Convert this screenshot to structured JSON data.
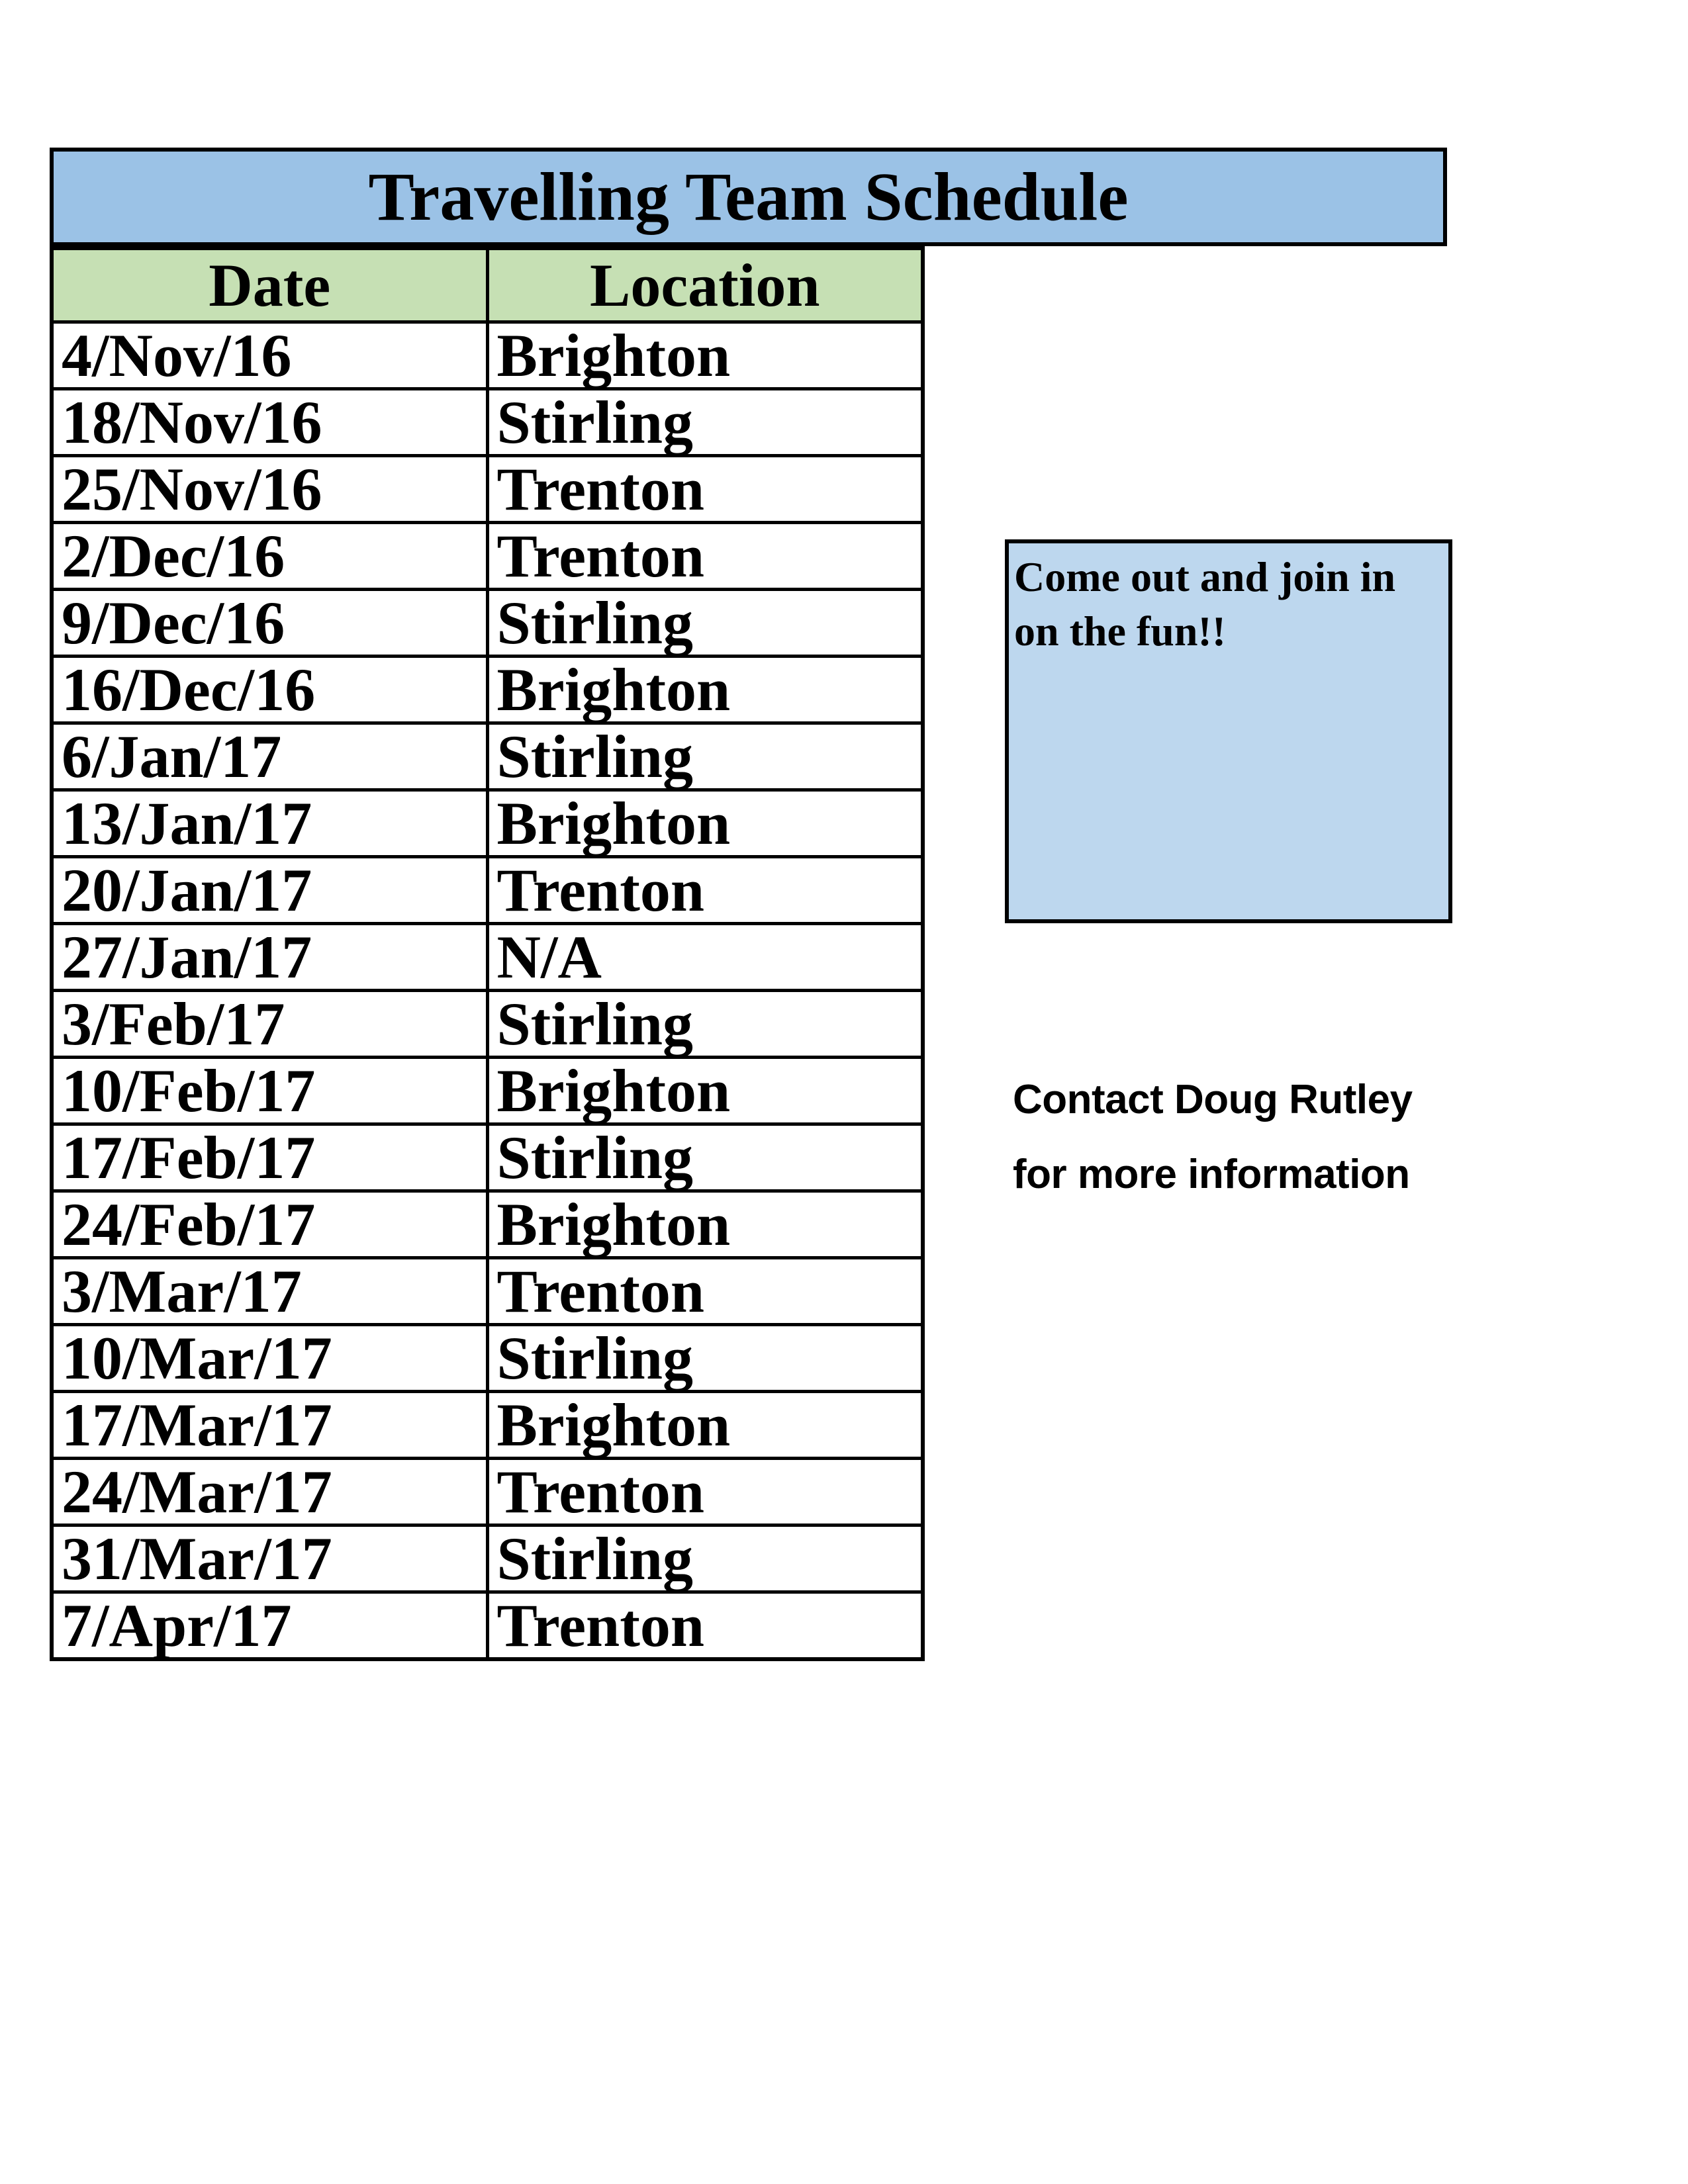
{
  "title": "Travelling Team Schedule",
  "table": {
    "headers": [
      "Date",
      "Location"
    ],
    "rows": [
      [
        "4/Nov/16",
        "Brighton"
      ],
      [
        "18/Nov/16",
        "Stirling"
      ],
      [
        "25/Nov/16",
        "Trenton"
      ],
      [
        "2/Dec/16",
        "Trenton"
      ],
      [
        "9/Dec/16",
        "Stirling"
      ],
      [
        "16/Dec/16",
        "Brighton"
      ],
      [
        "6/Jan/17",
        "Stirling"
      ],
      [
        "13/Jan/17",
        "Brighton"
      ],
      [
        "20/Jan/17",
        "Trenton"
      ],
      [
        "27/Jan/17",
        "N/A"
      ],
      [
        "3/Feb/17",
        "Stirling"
      ],
      [
        "10/Feb/17",
        "Brighton"
      ],
      [
        "17/Feb/17",
        "Stirling"
      ],
      [
        "24/Feb/17",
        "Brighton"
      ],
      [
        "3/Mar/17",
        "Trenton"
      ],
      [
        "10/Mar/17",
        "Stirling"
      ],
      [
        "17/Mar/17",
        "Brighton"
      ],
      [
        "24/Mar/17",
        "Trenton"
      ],
      [
        "31/Mar/17",
        "Stirling"
      ],
      [
        "7/Apr/17",
        "Trenton"
      ]
    ]
  },
  "note": "Come out and join in on the fun!!",
  "contact": {
    "line1": "Contact Doug Rutley",
    "line2": "for more information"
  },
  "colors": {
    "title_bg": "#9bc2e6",
    "header_bg": "#c6e0b4",
    "note_bg": "#bdd7ee"
  }
}
